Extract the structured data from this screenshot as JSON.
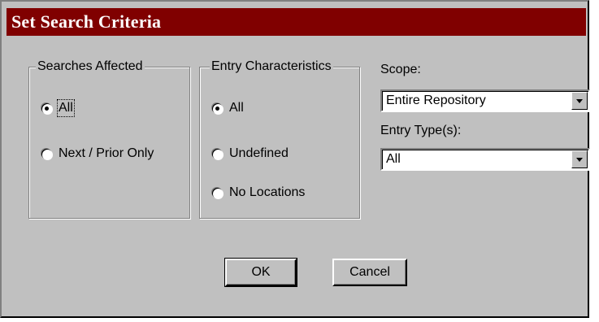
{
  "dialog": {
    "title": "Set Search Criteria"
  },
  "searches_affected": {
    "legend": "Searches Affected",
    "options": [
      {
        "label": "All",
        "checked": true
      },
      {
        "label": "Next / Prior Only",
        "checked": false
      }
    ]
  },
  "entry_characteristics": {
    "legend": "Entry Characteristics",
    "options": [
      {
        "label": "All",
        "checked": true
      },
      {
        "label": "Undefined",
        "checked": false
      },
      {
        "label": "No Locations",
        "checked": false
      }
    ]
  },
  "scope": {
    "label": "Scope:",
    "value": "Entire Repository"
  },
  "entry_types": {
    "label": "Entry Type(s):",
    "value": "All"
  },
  "buttons": {
    "ok": "OK",
    "cancel": "Cancel"
  },
  "colors": {
    "titlebar": "#800000",
    "face": "#c0c0c0"
  }
}
